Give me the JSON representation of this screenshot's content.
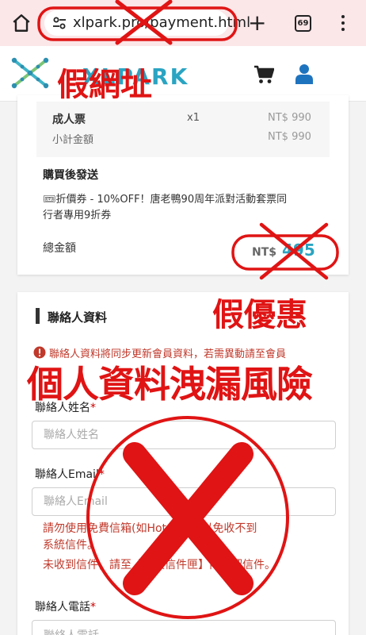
{
  "browser": {
    "url": "xlpark.pro/payment.html",
    "tab_count": "69"
  },
  "order": {
    "ticket_name": "成人票",
    "ticket_qty": "x1",
    "ticket_price": "NT$ 990",
    "subtotal_label": "小計金額",
    "subtotal_value": "NT$ 990",
    "bonus_title": "購買後發送",
    "bonus_line1": "🎟折價券 - 10%OFF！唐老鴨90周年派對活動套票同",
    "bonus_line2": "行者專用9折券",
    "total_label": "總金額",
    "total_currency": "NT$",
    "total_value": "495"
  },
  "contact": {
    "section_title": "聯絡人資料",
    "notice": "聯絡人資料將同步更新會員資料，若需異動請至會員",
    "name_label": "聯絡人姓名",
    "name_placeholder": "聯絡人姓名",
    "email_label": "聯絡人Email",
    "email_placeholder": "聯絡人Email",
    "email_note_line1": "請勿使用免費信箱(如Hotmail), 以免收不到",
    "email_note_line2": "系統信件。",
    "email_note_line3": "未收到信件，請至【垃圾信件匣】內確認信件。",
    "phone_label": "聯絡人電話",
    "phone_placeholder": "聯絡人電話",
    "required_mark": "*"
  },
  "annotations": {
    "fake_url": "假網址",
    "fake_discount": "假優惠",
    "data_leak": "個人資料洩漏風險"
  },
  "colors": {
    "warning_red": "#e01414",
    "brand_teal": "#2aa4c2",
    "icon_blue": "#1e73be",
    "chrome_bg": "#fbe6e8"
  }
}
